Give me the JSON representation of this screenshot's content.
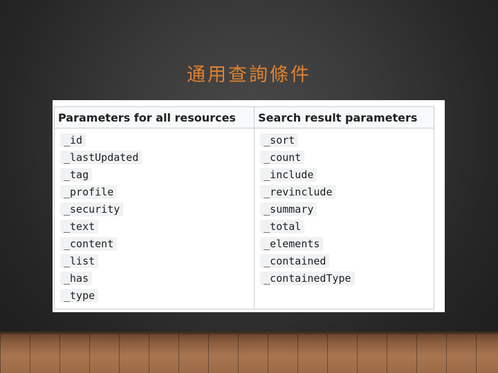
{
  "slide": {
    "title": "通用查詢條件"
  },
  "table": {
    "headers": [
      "Parameters for all resources",
      "Search result parameters"
    ],
    "column1": [
      "_id",
      "_lastUpdated",
      "_tag",
      "_profile",
      "_security",
      "_text",
      "_content",
      "_list",
      "_has",
      "_type"
    ],
    "column2": [
      "_sort",
      "_count",
      "_include",
      "_revinclude",
      "_summary",
      "_total",
      "_elements",
      "_contained",
      "_containedType"
    ]
  },
  "colors": {
    "title": "#e0812f",
    "background": "#333333",
    "table_header_bg": "#f8f9fa",
    "code_bg": "#f1f2f3",
    "border": "#c8ccd1"
  }
}
